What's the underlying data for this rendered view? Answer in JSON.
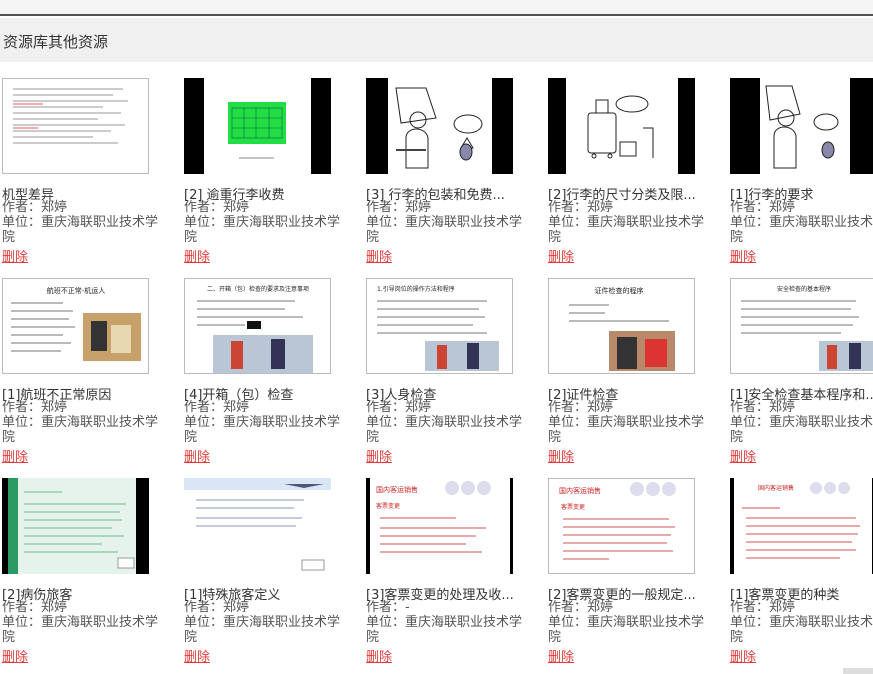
{
  "section": {
    "title": "资源库其他资源"
  },
  "labels": {
    "author_prefix": "作者：",
    "unit_prefix": "单位：",
    "delete": "删除"
  },
  "cards": [
    {
      "title": "机型差异",
      "author": "郑婷",
      "unit": "重庆海联职业技术学院"
    },
    {
      "title": "[2] 逾重行李收费",
      "author": "郑婷",
      "unit": "重庆海联职业技术学院"
    },
    {
      "title": "[3] 行李的包装和免费...",
      "author": "郑婷",
      "unit": "重庆海联职业技术学院"
    },
    {
      "title": "[2]行李的尺寸分类及限...",
      "author": "郑婷",
      "unit": "重庆海联职业技术学院"
    },
    {
      "title": "[1]行李的要求",
      "author": "郑婷",
      "unit": "重庆海联职业技术学院"
    },
    {
      "title": "[1]航班不正常原因",
      "author": "郑婷",
      "unit": "重庆海联职业技术学院"
    },
    {
      "title": "[4]开箱（包）检查",
      "author": "郑婷",
      "unit": "重庆海联职业技术学院"
    },
    {
      "title": "[3]人身检查",
      "author": "郑婷",
      "unit": "重庆海联职业技术学院"
    },
    {
      "title": "[2]证件检查",
      "author": "郑婷",
      "unit": "重庆海联职业技术学院"
    },
    {
      "title": "[1]安全检查基本程序和...",
      "author": "郑婷",
      "unit": "重庆海联职业技术学院"
    },
    {
      "title": "[2]病伤旅客",
      "author": "郑婷",
      "unit": "重庆海联职业技术学院"
    },
    {
      "title": "[1]特殊旅客定义",
      "author": "郑婷",
      "unit": "重庆海联职业技术学院"
    },
    {
      "title": "[3]客票变更的处理及收...",
      "author": "-",
      "unit": "重庆海联职业技术学院"
    },
    {
      "title": "[2]客票变更的一般规定...",
      "author": "郑婷",
      "unit": "重庆海联职业技术学院"
    },
    {
      "title": "[1]客票变更的种类",
      "author": "郑婷",
      "unit": "重庆海联职业技术学院"
    }
  ],
  "slides": {
    "s6": {
      "heading": "航班不正常-机运人"
    },
    "s7": {
      "heading": "二、开箱（包）检查的要求及注意事项"
    },
    "s8": {
      "heading": "1.引导岗位的操作方法和程序"
    },
    "s9": {
      "heading": "证件检查的程序"
    },
    "s10": {
      "heading": "安全检查的基本程序"
    },
    "s13": {
      "heading": "国内客运销售",
      "sub": "客票变更"
    },
    "s14": {
      "heading": "国内客运销售",
      "sub": "客票变更"
    },
    "s15": {
      "heading": "国内客运销售"
    }
  }
}
